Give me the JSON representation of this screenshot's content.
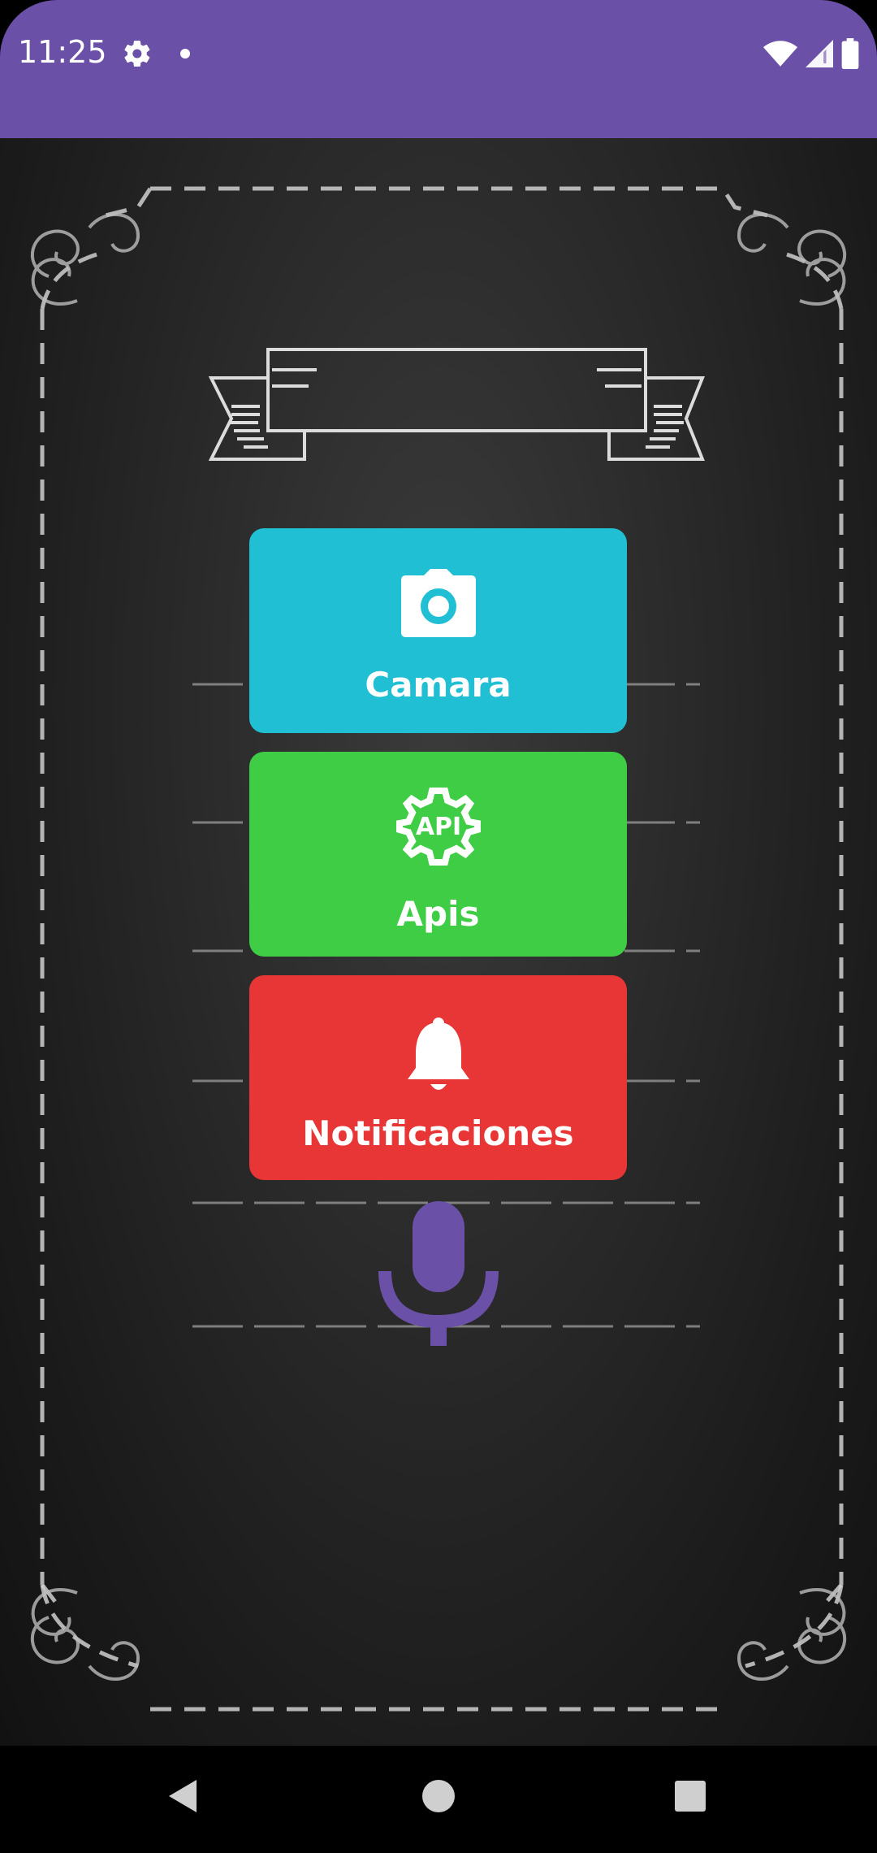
{
  "status_bar": {
    "time": "11:25",
    "icons": [
      "gear-icon",
      "dot-icon",
      "wifi-icon",
      "signal-icon",
      "battery-icon"
    ],
    "color": "#6a50a7"
  },
  "menu": {
    "items": [
      {
        "label": "Camara",
        "icon": "camera-icon",
        "color": "#21bfd4"
      },
      {
        "label": "Apis",
        "icon": "api-gear-icon",
        "icon_text": "API",
        "color": "#3ecd45"
      },
      {
        "label": "Notificaciones",
        "icon": "bell-icon",
        "color": "#e83535"
      }
    ]
  },
  "voice": {
    "icon": "microphone-icon",
    "color": "#6a50a7"
  },
  "nav_bar": {
    "buttons": [
      "back-icon",
      "home-icon",
      "recents-icon"
    ]
  }
}
